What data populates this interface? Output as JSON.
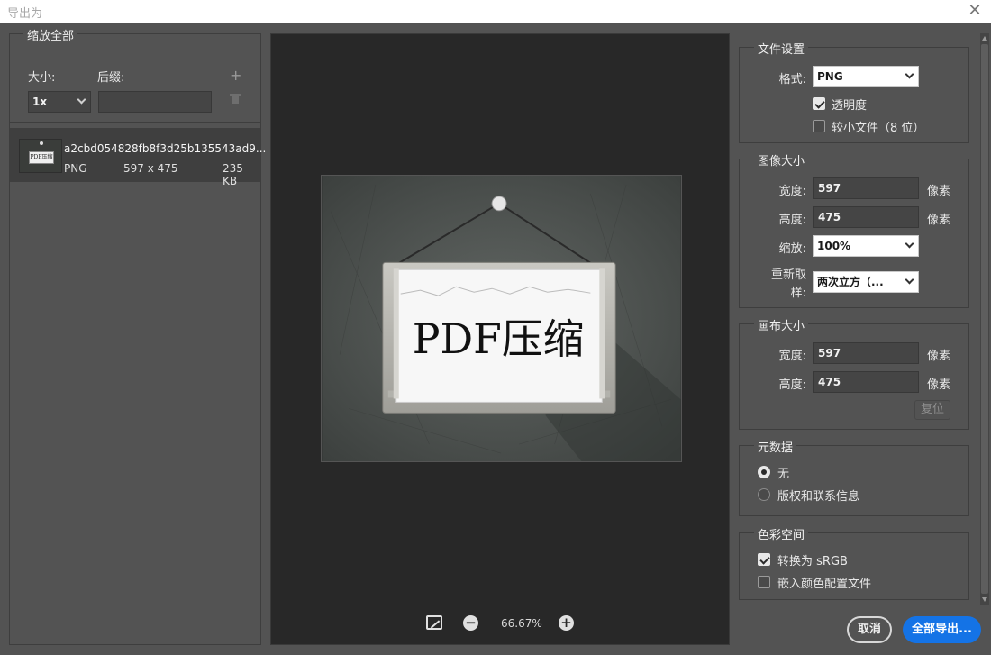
{
  "window": {
    "title": "导出为",
    "close_symbol": "✕"
  },
  "left": {
    "scale_section": "缩放全部",
    "size_label": "大小:",
    "suffix_label": "后缀:",
    "size_value": "1x",
    "suffix_value": "",
    "add_symbol": "+",
    "file": {
      "thumb_text": "PDF压缩",
      "name": "a2cbd054828fb8f3d25b135543ad9...",
      "format": "PNG",
      "dimensions": "597 x 475",
      "size": "235 KB"
    }
  },
  "preview": {
    "image_text": "PDF压缩",
    "zoom_value": "66.67%",
    "zoom_out_symbol": "−",
    "zoom_in_symbol": "+"
  },
  "file_settings": {
    "title": "文件设置",
    "format_label": "格式:",
    "format_value": "PNG",
    "transparency_label": "透明度",
    "transparency_checked": true,
    "smaller_file_label": "较小文件（8 位）",
    "smaller_file_checked": false
  },
  "image_size": {
    "title": "图像大小",
    "width_label": "宽度:",
    "width_value": "597",
    "height_label": "高度:",
    "height_value": "475",
    "unit": "像素",
    "scale_label": "缩放:",
    "scale_value": "100%",
    "resample_label_line1": "重新取",
    "resample_label_line2": "样:",
    "resample_value": "两次立方（..."
  },
  "canvas_size": {
    "title": "画布大小",
    "width_label": "宽度:",
    "width_value": "597",
    "height_label": "高度:",
    "height_value": "475",
    "unit": "像素",
    "reset_label": "复位"
  },
  "metadata": {
    "title": "元数据",
    "none_label": "无",
    "copyright_label": "版权和联系信息",
    "selected": "none"
  },
  "color_space": {
    "title": "色彩空间",
    "srgb_label": "转换为 sRGB",
    "srgb_checked": true,
    "embed_label": "嵌入颜色配置文件",
    "embed_checked": false
  },
  "buttons": {
    "cancel": "取消",
    "export_all": "全部导出..."
  },
  "colors": {
    "accent": "#1473e6",
    "panel": "#535353",
    "preview_bg": "#282828"
  }
}
